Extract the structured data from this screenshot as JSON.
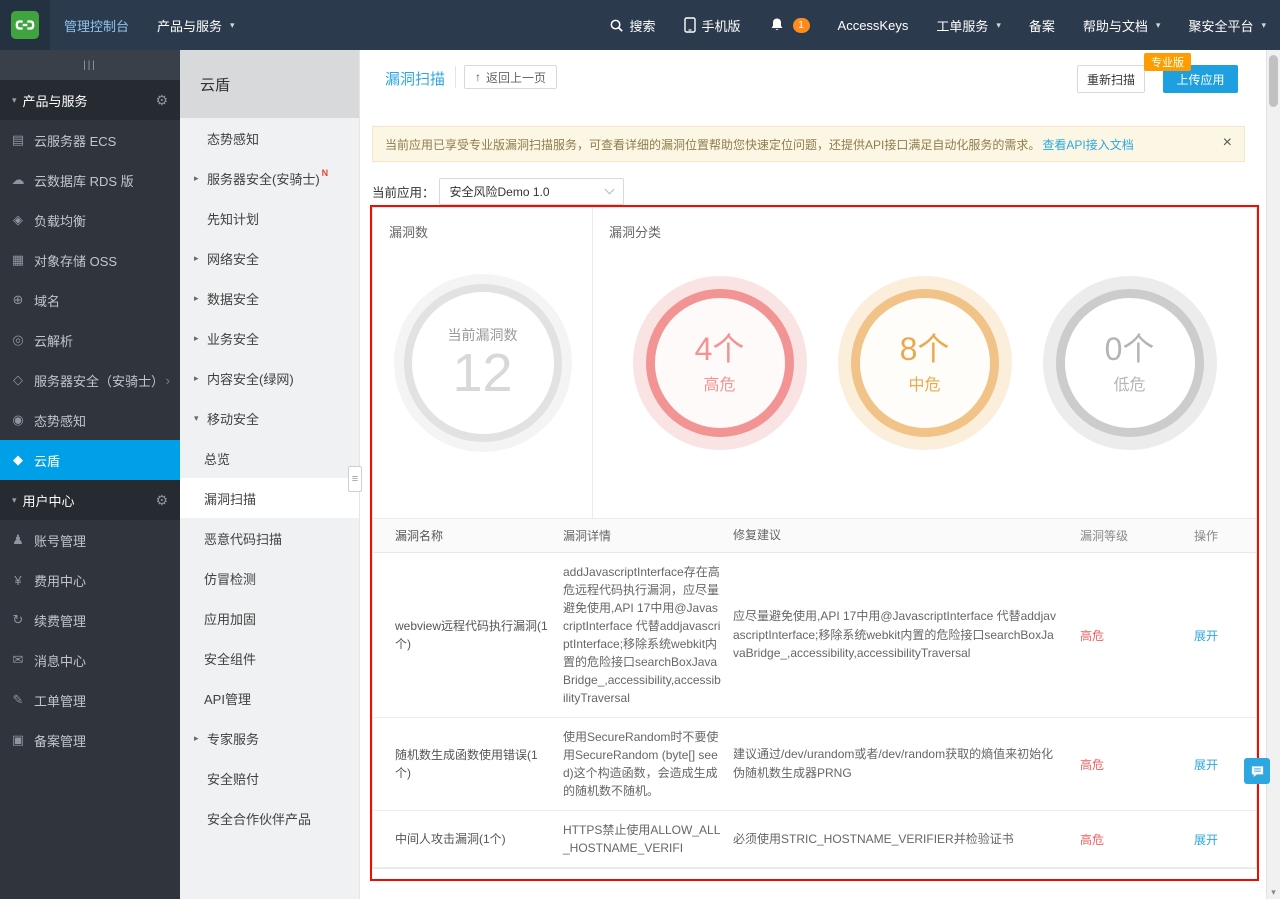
{
  "topnav": {
    "console": "管理控制台",
    "products": "产品与服务",
    "caret": "▾",
    "search": "搜索",
    "mobile": "手机版",
    "notification_count": "1",
    "accesskeys": "AccessKeys",
    "tickets": "工单服务",
    "beian": "备案",
    "help": "帮助与文档",
    "platform": "聚安全平台"
  },
  "sidebar": {
    "collapse": "|||",
    "gear": "⚙",
    "caret_down": "▾",
    "products_header": "产品与服务",
    "user_header": "用户中心",
    "items": [
      {
        "icon": "▤",
        "label": "云服务器 ECS"
      },
      {
        "icon": "☁",
        "label": "云数据库 RDS 版"
      },
      {
        "icon": "◈",
        "label": "负载均衡"
      },
      {
        "icon": "▦",
        "label": "对象存储 OSS"
      },
      {
        "icon": "⊕",
        "label": "域名"
      },
      {
        "icon": "◎",
        "label": "云解析"
      },
      {
        "icon": "◇",
        "label": "服务器安全（安骑士）",
        "arrow": "›"
      },
      {
        "icon": "◉",
        "label": "态势感知"
      },
      {
        "icon": "◆",
        "label": "云盾"
      }
    ],
    "user_items": [
      {
        "icon": "♟",
        "label": "账号管理"
      },
      {
        "icon": "¥",
        "label": "费用中心"
      },
      {
        "icon": "↻",
        "label": "续费管理"
      },
      {
        "icon": "✉",
        "label": "消息中心"
      },
      {
        "icon": "✎",
        "label": "工单管理"
      },
      {
        "icon": "▣",
        "label": "备案管理"
      }
    ]
  },
  "subsidebar": {
    "title": "云盾",
    "handle": "≡",
    "items": [
      {
        "label": "态势感知"
      },
      {
        "label": "服务器安全(安骑士)",
        "arrow": "▸",
        "badge": "N"
      },
      {
        "label": "先知计划"
      },
      {
        "label": "网络安全",
        "arrow": "▸"
      },
      {
        "label": "数据安全",
        "arrow": "▸"
      },
      {
        "label": "业务安全",
        "arrow": "▸"
      },
      {
        "label": "内容安全(绿网)",
        "arrow": "▸"
      },
      {
        "label": "移动安全",
        "arrow": "▾"
      },
      {
        "label": "总览"
      },
      {
        "label": "漏洞扫描"
      },
      {
        "label": "恶意代码扫描"
      },
      {
        "label": "仿冒检测"
      },
      {
        "label": "应用加固"
      },
      {
        "label": "安全组件"
      },
      {
        "label": "API管理"
      },
      {
        "label": "专家服务",
        "arrow": "▸"
      },
      {
        "label": "安全赔付"
      },
      {
        "label": "安全合作伙伴产品"
      }
    ]
  },
  "main": {
    "page_title": "漏洞扫描",
    "back_icon": "↑",
    "back_button": "返回上一页",
    "pro_badge": "专业版",
    "rescan_button": "重新扫描",
    "upload_button": "上传应用",
    "banner": {
      "text": "当前应用已享受专业版漏洞扫描服务，可查看详细的漏洞位置帮助您快速定位问题，还提供API接口满足自动化服务的需求。",
      "link": "查看API接入文档",
      "close": "×"
    },
    "app_selector": {
      "label": "当前应用：",
      "value": "安全风险Demo 1.0"
    },
    "stats": {
      "count_panel_title": "漏洞数",
      "count_label": "当前漏洞数",
      "count_value": "12",
      "category_panel_title": "漏洞分类",
      "categories": [
        {
          "count": "4个",
          "label": "高危",
          "color": "#f19493"
        },
        {
          "count": "8个",
          "label": "中危",
          "color": "#eba94f"
        },
        {
          "count": "0个",
          "label": "低危",
          "color": "#b5b5b5"
        }
      ]
    },
    "table": {
      "headers": [
        "漏洞名称",
        "漏洞详情",
        "修复建议",
        "漏洞等级",
        "操作"
      ],
      "rows": [
        {
          "name": "webview远程代码执行漏洞(1个)",
          "detail": "addJavascriptInterface存在高危远程代码执行漏洞，应尽量避免使用,API 17中用@JavascriptInterface 代替addjavascriptInterface;移除系统webkit内置的危险接口searchBoxJavaBridge_,accessibility,accessibilityTraversal",
          "fix": "应尽量避免使用,API 17中用@JavascriptInterface 代替addjavascriptInterface;移除系统webkit内置的危险接口searchBoxJavaBridge_,accessibility,accessibilityTraversal",
          "level": "高危",
          "action": "展开"
        },
        {
          "name": "随机数生成函数使用错误(1个)",
          "detail": "使用SecureRandom时不要使用SecureRandom (byte[] seed)这个构造函数，会造成生成的随机数不随机。",
          "fix": "建议通过/dev/urandom或者/dev/random获取的熵值来初始化伪随机数生成器PRNG",
          "level": "高危",
          "action": "展开"
        },
        {
          "name": "中间人攻击漏洞(1个)",
          "detail": "HTTPS禁止使用ALLOW_ALL_HOSTNAME_VERIFI",
          "fix": "必须使用STRIC_HOSTNAME_VERIFIER并检验证书",
          "level": "高危",
          "action": "展开"
        }
      ]
    }
  },
  "misc": {
    "scroll_down_arrow": "▾"
  }
}
